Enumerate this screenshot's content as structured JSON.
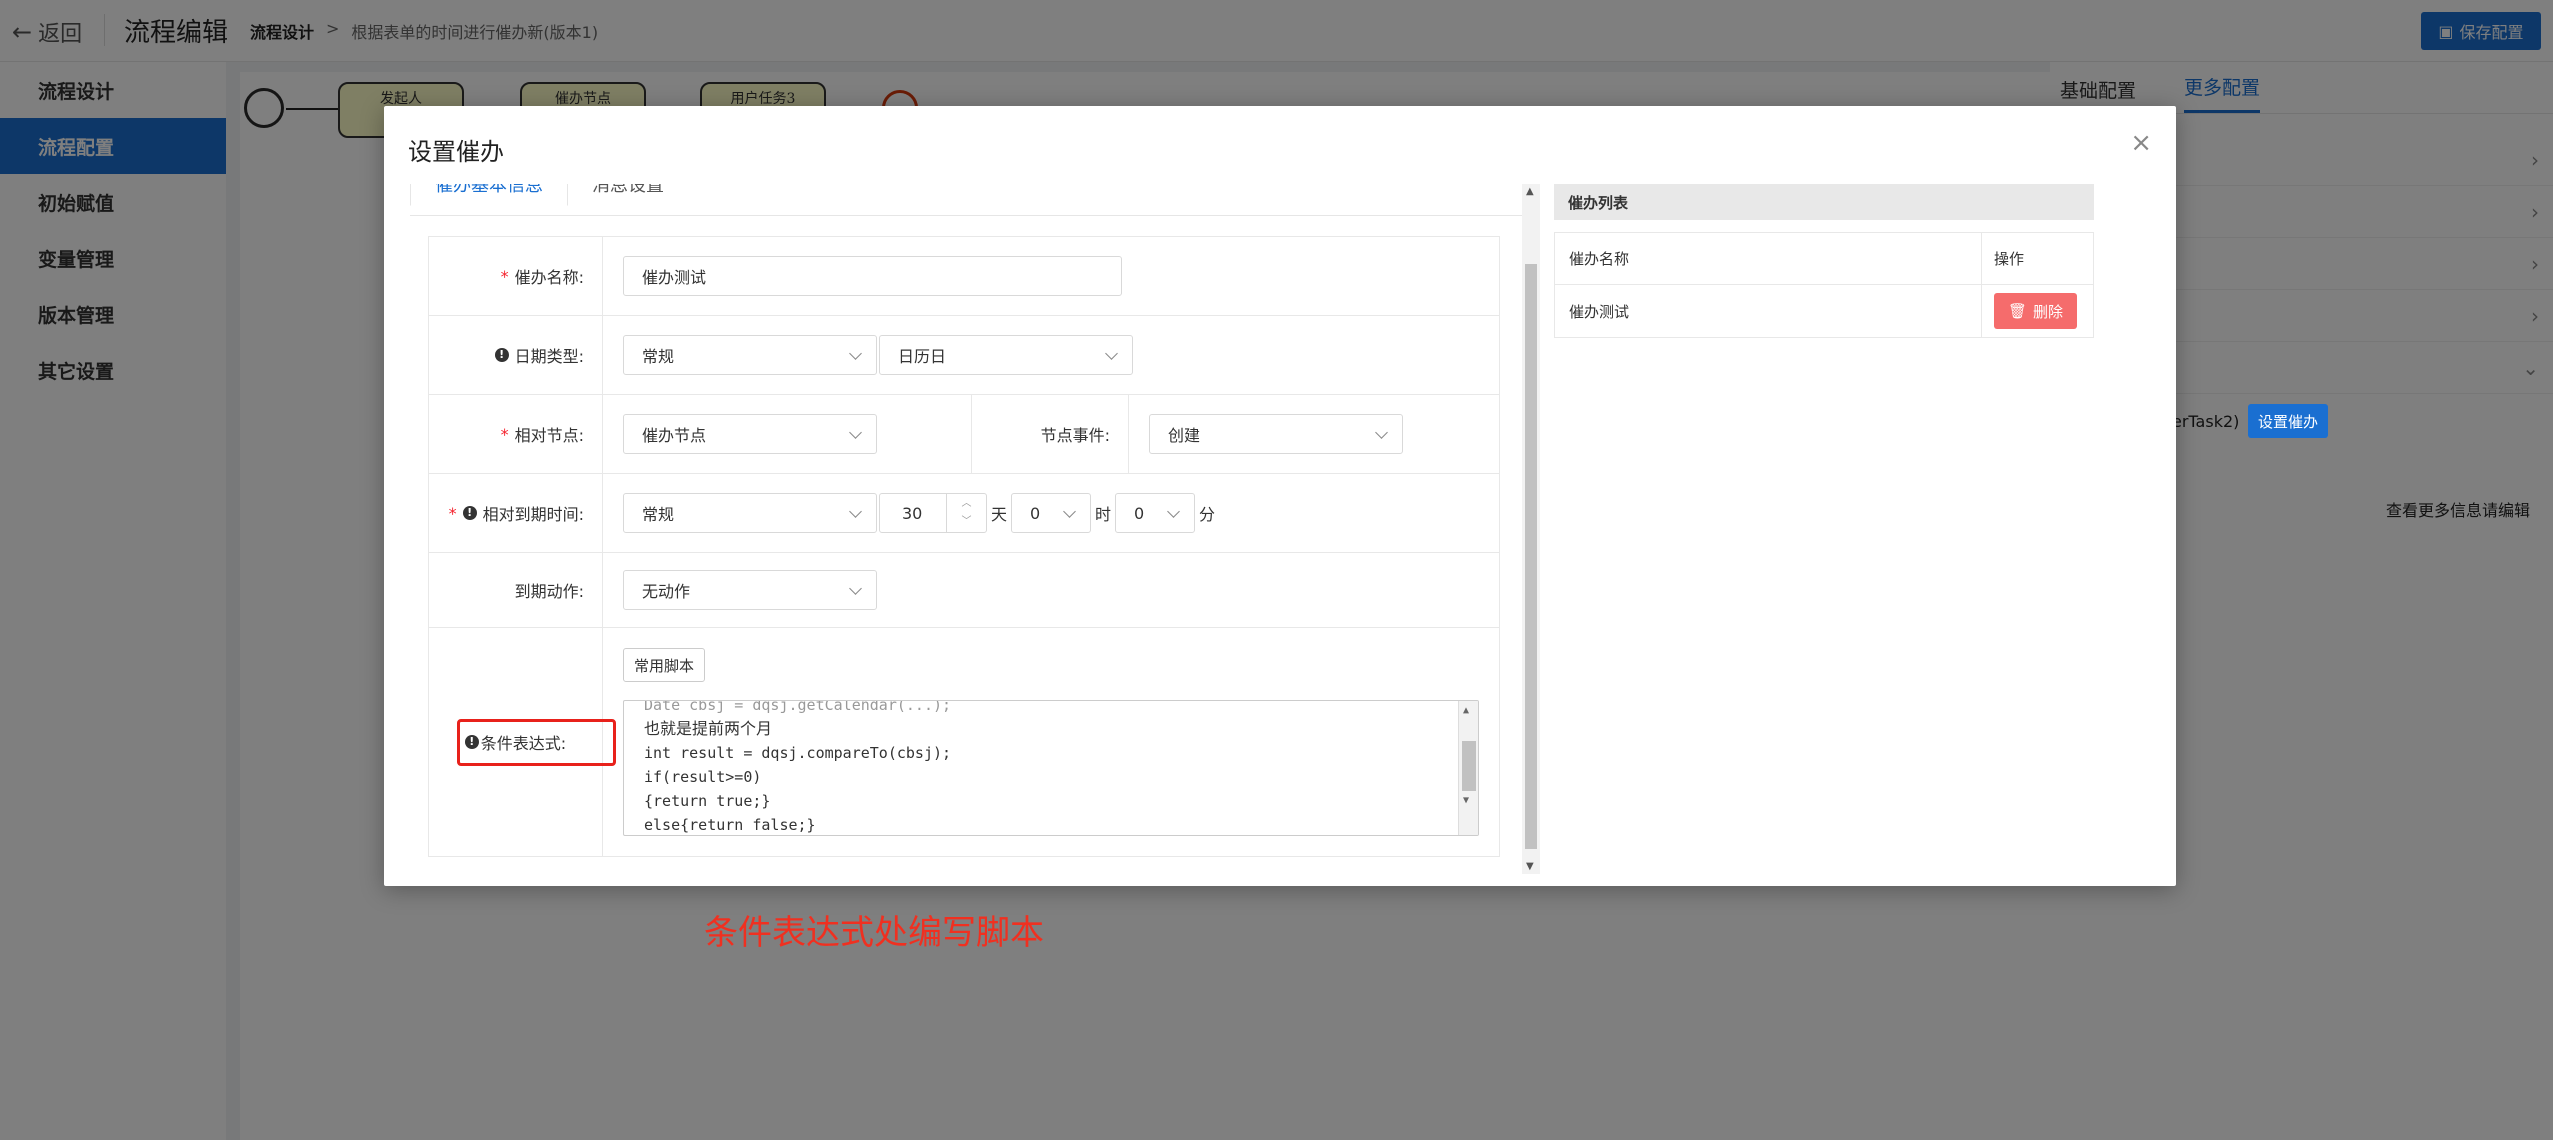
{
  "header": {
    "back_label": "返回",
    "title": "流程编辑",
    "breadcrumb": [
      "流程设计",
      "根据表单的时间进行催办新(版本1)"
    ],
    "save_label": "保存配置"
  },
  "sidebar": {
    "items": [
      {
        "label": "流程设计"
      },
      {
        "label": "流程配置"
      },
      {
        "label": "初始赋值"
      },
      {
        "label": "变量管理"
      },
      {
        "label": "版本管理"
      },
      {
        "label": "其它设置"
      }
    ]
  },
  "diagram": {
    "tasks": [
      "发起人",
      "催办节点",
      "用户任务3"
    ]
  },
  "right_panel": {
    "tabs": [
      "基础配置",
      "更多配置"
    ],
    "task_text": "erTask2)",
    "set_reminder_label": "设置催办",
    "more_info_text": "查看更多信息请编辑"
  },
  "modal": {
    "title": "设置催办",
    "close": "×",
    "tabs": [
      "催办基本信息",
      "消息设置"
    ],
    "form": {
      "name_label": "催办名称:",
      "name_value": "催办测试",
      "date_type_label": "日期类型:",
      "date_type_value": "常规",
      "calendar_value": "日历日",
      "relative_node_label": "相对节点:",
      "relative_node_value": "催办节点",
      "node_event_label": "节点事件:",
      "node_event_value": "创建",
      "due_label": "相对到期时间:",
      "due_type_value": "常规",
      "days_value": "30",
      "days_unit": "天",
      "hours_value": "0",
      "hours_unit": "时",
      "minutes_value": "0",
      "minutes_unit": "分",
      "action_label": "到期动作:",
      "action_value": "无动作",
      "script_button": "常用脚本",
      "condition_label": "条件表达式:",
      "code_lines": [
        "Date cbsj = dqsj.getCalendar(...);",
        "也就是提前两个月",
        "int result = dqsj.compareTo(cbsj);",
        "if(result>=0)",
        "{return true;}",
        "else{return false;}"
      ]
    },
    "list": {
      "title": "催办列表",
      "col_name": "催办名称",
      "col_action": "操作",
      "rows": [
        {
          "name": "催办测试",
          "delete_label": "删除"
        }
      ]
    }
  },
  "annotation": "条件表达式处编写脚本"
}
